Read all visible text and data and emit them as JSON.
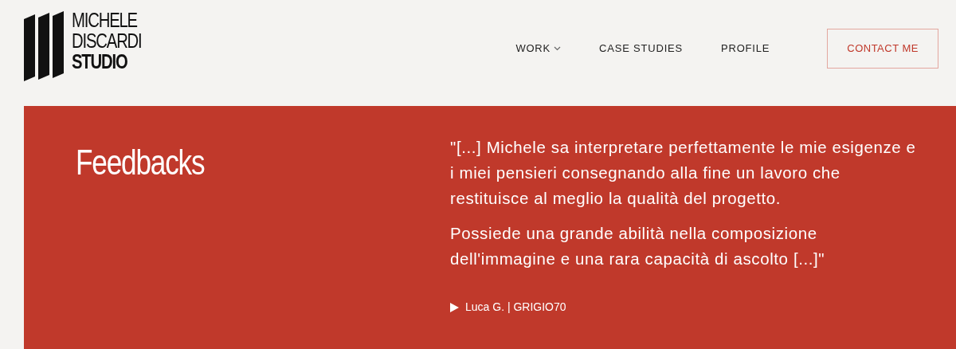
{
  "logo": {
    "lines": [
      "MICHELE",
      "DISCARDI",
      "STUDIO"
    ]
  },
  "nav": [
    {
      "label": "WORK",
      "dropdown": true
    },
    {
      "label": "CASE STUDIES",
      "dropdown": false
    },
    {
      "label": "PROFILE",
      "dropdown": false
    }
  ],
  "contact_button": "CONTACT ME",
  "feedbacks": {
    "title": "Feedbacks",
    "paragraphs": [
      "\"[...] Michele sa interpretare perfettamente le mie esigenze e i miei pensieri consegnando alla fine un lavoro che restituisce al meglio la qualità del progetto.",
      "Possiede una grande abilità nella composizione dell'immagine e una rara capacità di ascolto [...]\""
    ],
    "author": "Luca G. | GRIGIO70"
  }
}
